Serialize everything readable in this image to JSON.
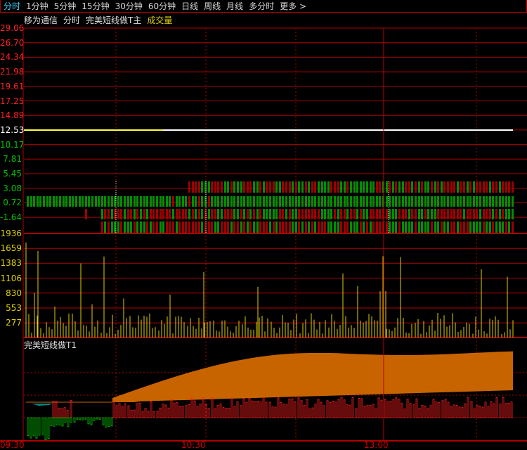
{
  "tabs": [
    "分时",
    "1分钟",
    "5分钟",
    "15分钟",
    "30分钟",
    "60分钟",
    "日线",
    "周线",
    "月线",
    "多分时",
    "更多 >"
  ],
  "active_tab": "分时",
  "subheader": {
    "move": "移为通信",
    "mode": "分时",
    "indicator": "完美短线做T主",
    "volume": "成交量"
  },
  "price_axis": [
    "29.06",
    "26.70",
    "24.34",
    "21.98",
    "19.61",
    "17.25",
    "14.89",
    "12.53",
    "10.17",
    "7.81",
    "5.45",
    "3.08",
    "0.72",
    "-1.64"
  ],
  "volume_axis": [
    "1936",
    "1659",
    "1383",
    "1106",
    "830",
    "553",
    "277"
  ],
  "indicator_label": "完美短线做T1",
  "time_labels": [
    "09:30",
    "10:30",
    "13:00"
  ],
  "colors": {
    "up": "#ff2020",
    "down": "#00c000",
    "grid": "#b00000",
    "volume": "#e0d000",
    "area": "#c86400"
  }
}
